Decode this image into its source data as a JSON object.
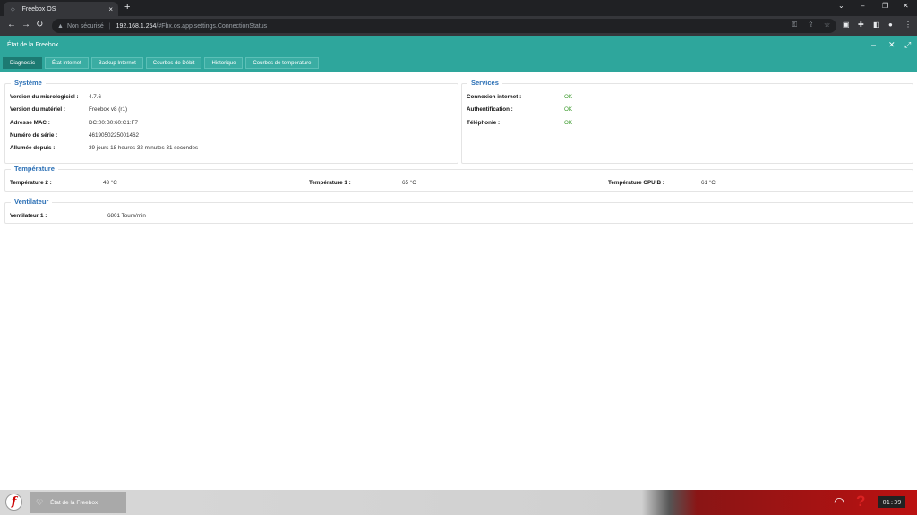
{
  "browser": {
    "tab_title": "Freebox OS",
    "tab_close": "×",
    "new_tab": "+",
    "security_label": "Non sécurisé",
    "url_host": "192.168.1.254",
    "url_path": "/#Fbx.os.app.settings.ConnectionStatus"
  },
  "app": {
    "title": "État de la Freebox",
    "tabs": [
      "Diagnostic",
      "État Internet",
      "Backup Internet",
      "Courbes de Débit",
      "Historique",
      "Courbes de température"
    ],
    "active_tab": "Diagnostic"
  },
  "systeme": {
    "title": "Système",
    "rows": [
      {
        "label": "Version du micrologiciel :",
        "value": "4.7.6"
      },
      {
        "label": "Version du matériel :",
        "value": "Freebox v8 (r1)"
      },
      {
        "label": "Adresse MAC :",
        "value": "DC:00:B0:60:C1:F7"
      },
      {
        "label": "Numéro de série :",
        "value": "4619050225001462"
      },
      {
        "label": "Allumée depuis :",
        "value": "39 jours 18 heures 32 minutes 31 secondes"
      }
    ]
  },
  "services": {
    "title": "Services",
    "rows": [
      {
        "label": "Connexion internet :",
        "value": "OK"
      },
      {
        "label": "Authentification :",
        "value": "OK"
      },
      {
        "label": "Téléphonie :",
        "value": "OK"
      }
    ]
  },
  "temperature": {
    "title": "Température",
    "items": [
      {
        "label": "Température 2 :",
        "value": "43 °C"
      },
      {
        "label": "Température 1 :",
        "value": "65 °C"
      },
      {
        "label": "Température CPU B :",
        "value": "61 °C"
      }
    ]
  },
  "ventilateur": {
    "title": "Ventilateur",
    "items": [
      {
        "label": "Ventilateur 1 :",
        "value": "6801 Tours/min"
      }
    ]
  },
  "taskbar": {
    "logo": "f",
    "window_label": "État de la Freebox",
    "clock": "01:39"
  },
  "colors": {
    "accent": "#2ea69c",
    "active_tab": "#1c7a72",
    "section_title": "#2a6fb5",
    "ok": "#3a9a2a"
  }
}
